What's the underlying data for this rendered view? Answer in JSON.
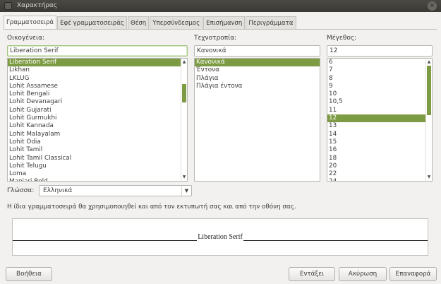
{
  "window": {
    "title": "Χαρακτήρας"
  },
  "tabs": [
    {
      "label": "Γραμματοσειρά"
    },
    {
      "label": "Εφέ γραμματοσειράς"
    },
    {
      "label": "Θέση"
    },
    {
      "label": "Υπερσύνδεσμος"
    },
    {
      "label": "Επισήμανση"
    },
    {
      "label": "Περιγράμματα"
    }
  ],
  "family": {
    "label": "Οικογένεια:",
    "value": "Liberation Serif",
    "items": [
      "Liberation Serif",
      "Likhan",
      "LKLUG",
      "Lohit Assamese",
      "Lohit Bengali",
      "Lohit Devanagari",
      "Lohit Gujarati",
      "Lohit Gurmukhi",
      "Lohit Kannada",
      "Lohit Malayalam",
      "Lohit Odia",
      "Lohit Tamil",
      "Lohit Tamil Classical",
      "Lohit Telugu",
      "Loma",
      "Manjari Bold"
    ],
    "selected": "Liberation Serif"
  },
  "style": {
    "label": "Τεχνοτροπία:",
    "value": "Κανονικά",
    "items": [
      "Κανονικά",
      "Έντονα",
      "Πλάγια",
      "Πλάγια έντονα"
    ],
    "selected": "Κανονικά"
  },
  "size": {
    "label": "Μέγεθος:",
    "value": "12",
    "items": [
      "6",
      "7",
      "8",
      "9",
      "10",
      "10,5",
      "11",
      "12",
      "13",
      "14",
      "15",
      "16",
      "18",
      "20",
      "22",
      "24"
    ],
    "selected": "12"
  },
  "language": {
    "label": "Γλώσσα:",
    "value": "Ελληνικά"
  },
  "info_text": "Η ίδια γραμματοσειρά θα χρησιμοποιηθεί και από τον εκτυπωτή σας και από την οθόνη σας.",
  "preview_text": "Liberation Serif",
  "buttons": {
    "help": "Βοήθεια",
    "ok": "Εντάξει",
    "cancel": "Ακύρωση",
    "reset": "Επαναφορά"
  },
  "colors": {
    "accent": "#7c9b42",
    "titlebar": "#3c3b37"
  }
}
